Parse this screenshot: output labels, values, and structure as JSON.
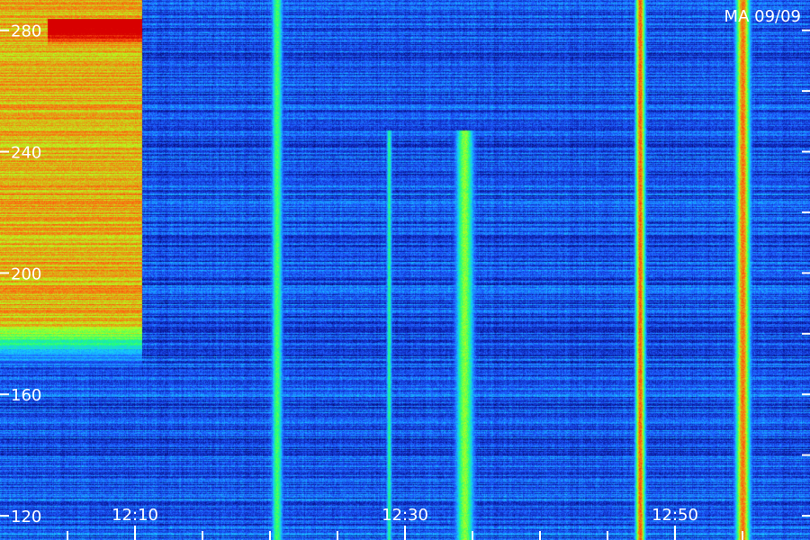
{
  "chart_data": {
    "type": "heatmap",
    "title": "",
    "station_label": "MA 09/09",
    "xlabel": "",
    "ylabel": "",
    "x_ticks": [
      {
        "value": 10,
        "label": "12:10"
      },
      {
        "value": 30,
        "label": "12:30"
      },
      {
        "value": 50,
        "label": "12:50"
      }
    ],
    "x_minor_tick_minutes": [
      5,
      10,
      15,
      20,
      25,
      30,
      35,
      40,
      45,
      50,
      55
    ],
    "xlim_minutes_after_12h": [
      0,
      60
    ],
    "y_ticks": [
      120,
      160,
      200,
      240,
      280
    ],
    "ylim": [
      112,
      290
    ],
    "colormap": [
      "#000018",
      "#0a1aa0",
      "#1e5aff",
      "#16c8ff",
      "#22ff7a",
      "#b4ff1e",
      "#ff6a10",
      "#d80000"
    ],
    "features": [
      {
        "kind": "broadband_burst",
        "x_start": 0,
        "x_end": 10.5,
        "y_min": 165,
        "y_max": 290,
        "intensity": 0.72
      },
      {
        "kind": "broadband_burst_core",
        "x_start": 3.5,
        "x_end": 10.5,
        "y_min": 262,
        "y_max": 284,
        "intensity": 1.0
      },
      {
        "kind": "vertical_stripe",
        "x": 20.5,
        "width": 1.0,
        "y_min": 112,
        "y_max": 290,
        "intensity": 0.55
      },
      {
        "kind": "vertical_stripe",
        "x": 28.8,
        "width": 0.5,
        "y_min": 112,
        "y_max": 247,
        "intensity": 0.5
      },
      {
        "kind": "vertical_stripe",
        "x": 34.4,
        "width": 1.6,
        "y_min": 112,
        "y_max": 247,
        "intensity": 0.62
      },
      {
        "kind": "vertical_stripe",
        "x": 47.4,
        "width": 0.9,
        "y_min": 112,
        "y_max": 290,
        "intensity": 0.82
      },
      {
        "kind": "vertical_stripe",
        "x": 55.0,
        "width": 1.3,
        "y_min": 112,
        "y_max": 290,
        "intensity": 0.8
      }
    ]
  }
}
